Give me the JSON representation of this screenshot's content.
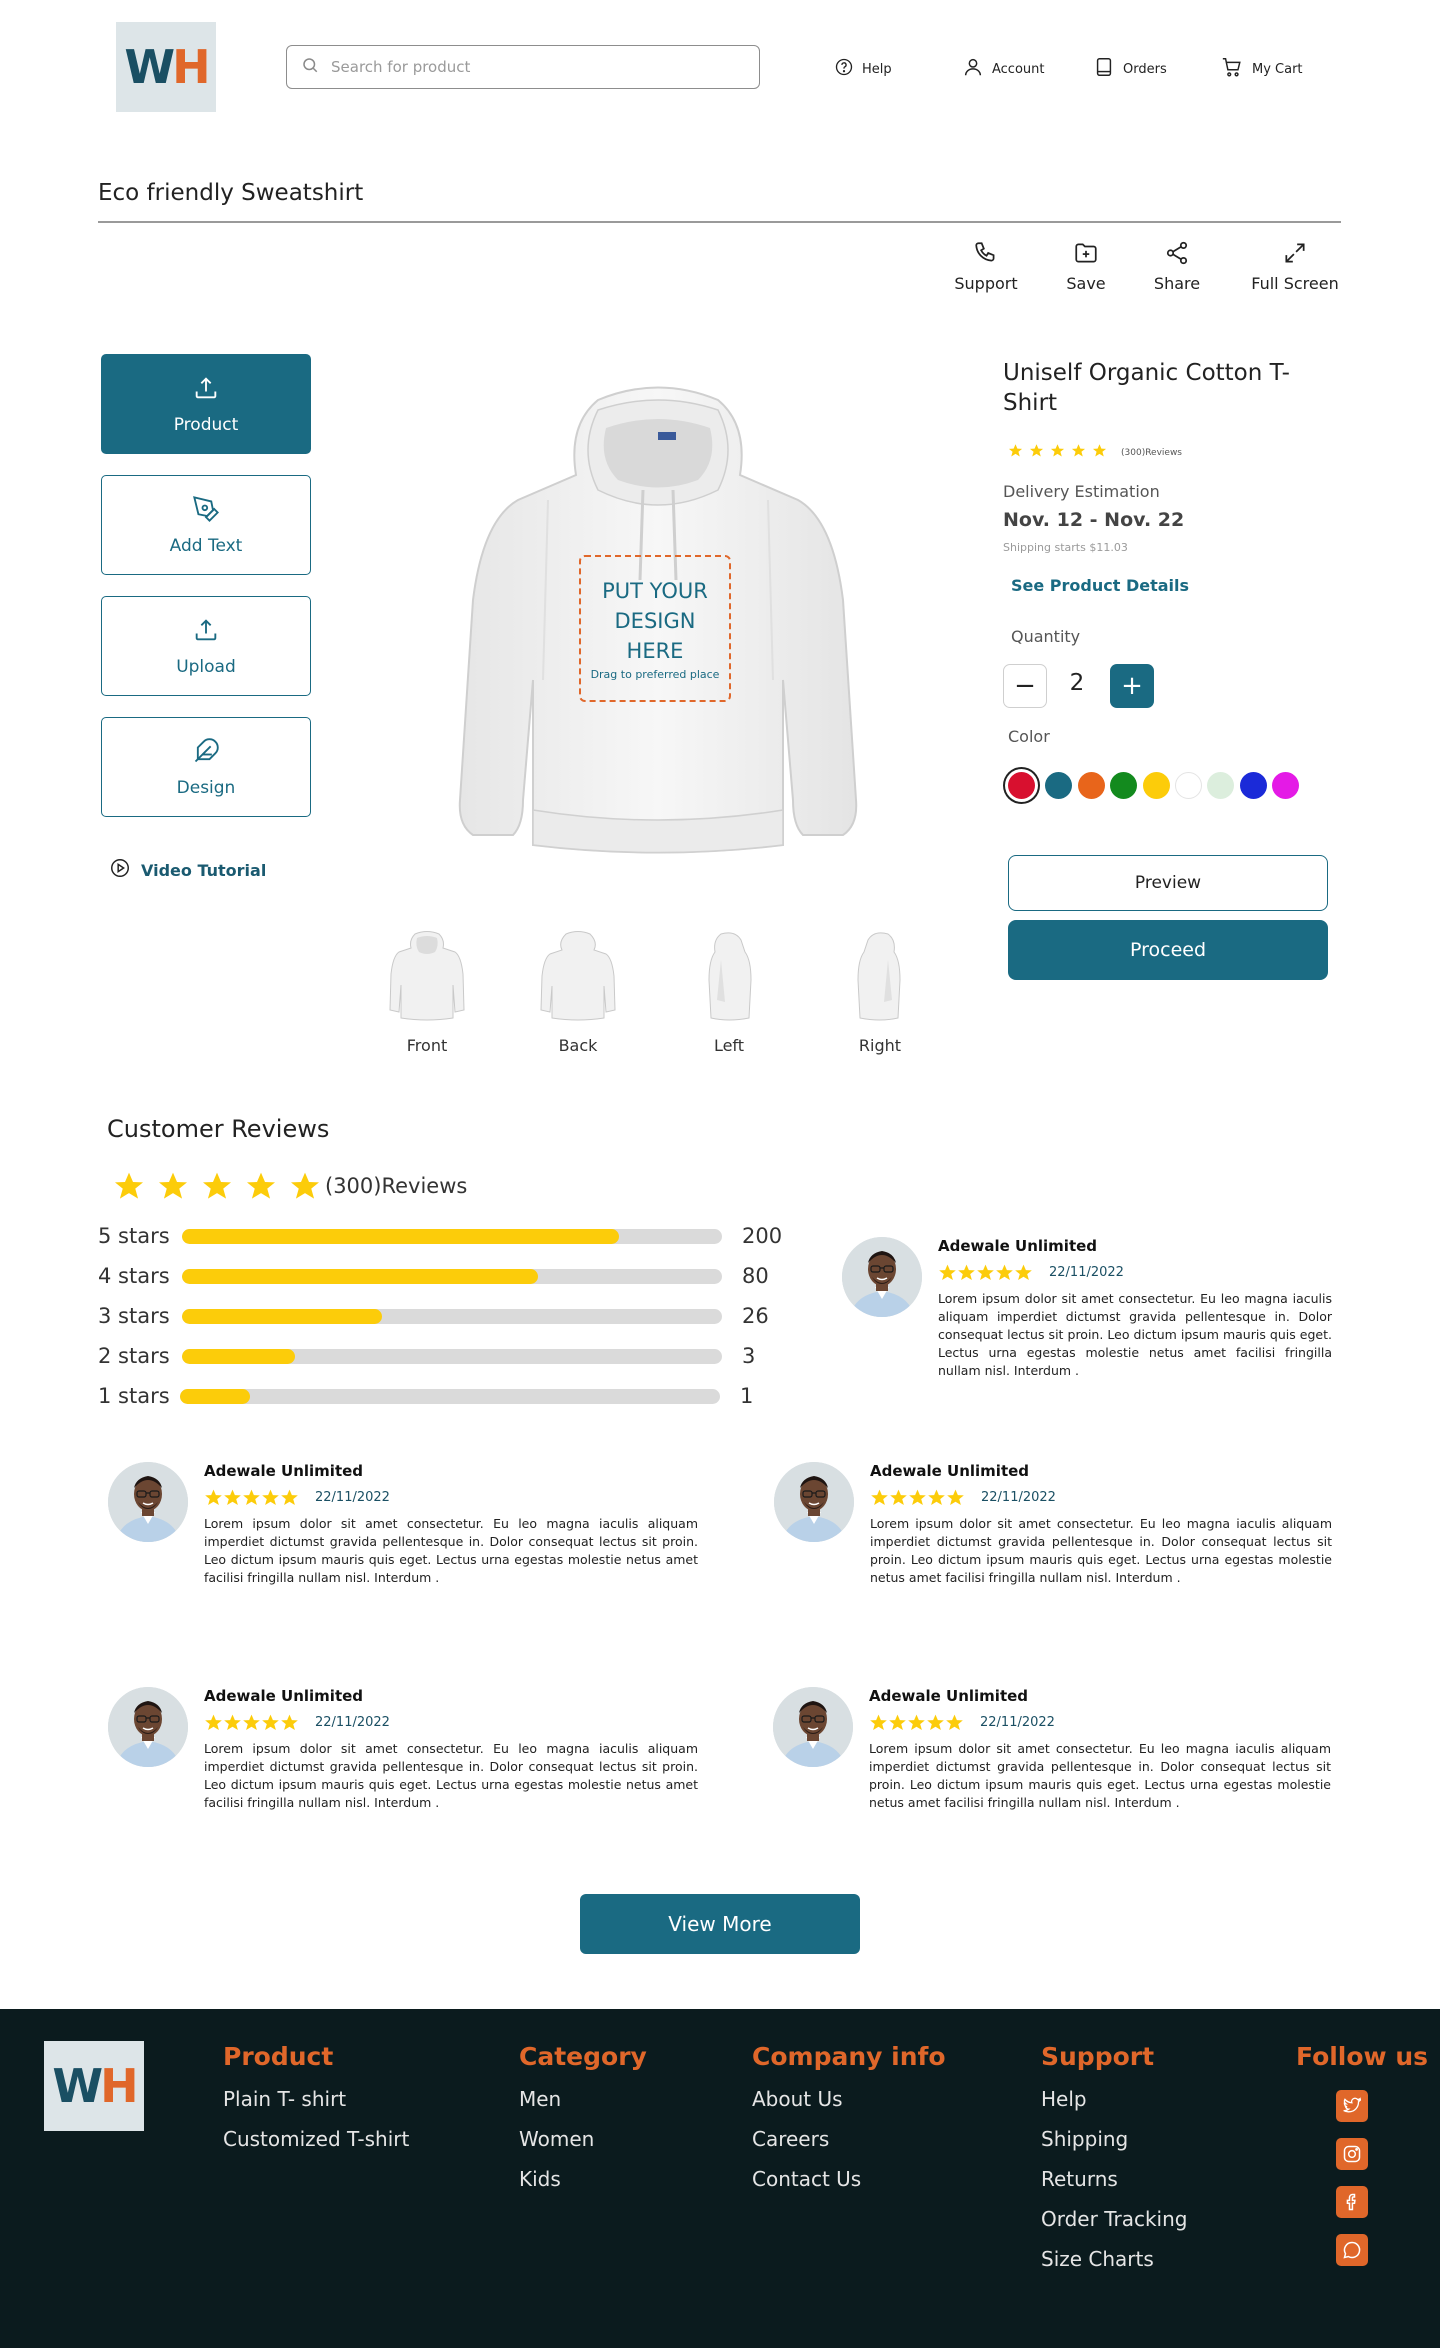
{
  "brand": {
    "logo_w": "W",
    "logo_h": "H"
  },
  "header": {
    "search_placeholder": "Search for product",
    "nav": [
      {
        "label": "Help",
        "icon": "help-circle-icon"
      },
      {
        "label": "Account",
        "icon": "user-icon"
      },
      {
        "label": "Orders",
        "icon": "orders-icon"
      },
      {
        "label": "My Cart",
        "icon": "cart-icon"
      }
    ]
  },
  "page_title": "Eco friendly Sweatshirt",
  "toolbar": [
    {
      "label": "Support",
      "icon": "phone-icon"
    },
    {
      "label": "Save",
      "icon": "folder-plus-icon"
    },
    {
      "label": "Share",
      "icon": "share-icon"
    },
    {
      "label": "Full Screen",
      "icon": "expand-icon"
    }
  ],
  "side_tools": [
    {
      "label": "Product",
      "icon": "upload-icon",
      "active": true
    },
    {
      "label": "Add Text",
      "icon": "pen-tool-icon",
      "active": false
    },
    {
      "label": "Upload",
      "icon": "upload-icon",
      "active": false
    },
    {
      "label": "Design",
      "icon": "feather-icon",
      "active": false
    }
  ],
  "video_tutorial": "Video Tutorial",
  "design_area": {
    "line1": "PUT YOUR",
    "line2": "DESIGN",
    "line3": "HERE",
    "hint": "Drag to preferred place"
  },
  "views": [
    "Front",
    "Back",
    "Left",
    "Right"
  ],
  "product": {
    "name": "Uniself Organic Cotton T-Shirt",
    "rating": 5,
    "reviews_small": "(300)Reviews",
    "delivery_label": "Delivery Estimation",
    "delivery_date": "Nov. 12 - Nov. 22",
    "shipping": "Shipping starts $11.03",
    "see_details": "See Product Details",
    "quantity_label": "Quantity",
    "quantity": "2",
    "color_label": "Color",
    "colors": [
      "#d8102f",
      "#1a6a82",
      "#e8651b",
      "#138a1e",
      "#fccc0a",
      "#ffffff",
      "#dceedd",
      "#1b2ad8",
      "#e41ae6"
    ],
    "selected_color": "#d8102f",
    "preview": "Preview",
    "proceed": "Proceed"
  },
  "reviews": {
    "title": "Customer Reviews",
    "rating": 5,
    "count_text": "(300)Reviews",
    "breakdown": [
      {
        "label": "5 stars",
        "count": "200",
        "fraction": 0.81
      },
      {
        "label": "4 stars",
        "count": "80",
        "fraction": 0.66
      },
      {
        "label": "3 stars",
        "count": "26",
        "fraction": 0.37
      },
      {
        "label": "2 stars",
        "count": "3",
        "fraction": 0.21
      },
      {
        "label": "1 stars",
        "count": "1",
        "fraction": 0.13
      }
    ],
    "items": [
      {
        "name": "Adewale Unlimited",
        "date": "22/11/2022",
        "rating": 5,
        "text": "Lorem ipsum dolor sit amet consectetur. Eu leo magna iaculis aliquam imperdiet dictumst gravida pellentesque in. Dolor consequat lectus sit proin. Leo dictum ipsum mauris quis eget. Lectus urna egestas molestie netus amet facilisi fringilla nullam nisl. Interdum ."
      },
      {
        "name": "Adewale Unlimited",
        "date": "22/11/2022",
        "rating": 5,
        "text": "Lorem ipsum dolor sit amet consectetur. Eu leo magna iaculis aliquam imperdiet dictumst gravida pellentesque in. Dolor consequat lectus sit proin. Leo dictum ipsum mauris quis eget. Lectus urna egestas molestie netus amet facilisi fringilla nullam nisl. Interdum ."
      },
      {
        "name": "Adewale Unlimited",
        "date": "22/11/2022",
        "rating": 5,
        "text": "Lorem ipsum dolor sit amet consectetur. Eu leo magna iaculis aliquam imperdiet dictumst gravida pellentesque in. Dolor consequat lectus sit proin. Leo dictum ipsum mauris quis eget. Lectus urna egestas molestie netus amet facilisi fringilla nullam nisl. Interdum ."
      },
      {
        "name": "Adewale Unlimited",
        "date": "22/11/2022",
        "rating": 5,
        "text": "Lorem ipsum dolor sit amet consectetur. Eu leo magna iaculis aliquam imperdiet dictumst gravida pellentesque in. Dolor consequat lectus sit proin. Leo dictum ipsum mauris quis eget. Lectus urna egestas molestie netus amet facilisi fringilla nullam nisl. Interdum ."
      },
      {
        "name": "Adewale Unlimited",
        "date": "22/11/2022",
        "rating": 5,
        "text": "Lorem ipsum dolor sit amet consectetur. Eu leo magna iaculis aliquam imperdiet dictumst gravida pellentesque in. Dolor consequat lectus sit proin. Leo dictum ipsum mauris quis eget. Lectus urna egestas molestie netus amet facilisi fringilla nullam nisl. Interdum ."
      }
    ],
    "view_more": "View More"
  },
  "footer": {
    "columns": [
      {
        "heading": "Product",
        "links": [
          "Plain T- shirt",
          "Customized T-shirt"
        ]
      },
      {
        "heading": "Category",
        "links": [
          "Men",
          "Women",
          "Kids"
        ]
      },
      {
        "heading": "Company info",
        "links": [
          "About Us",
          "Careers",
          "Contact Us"
        ]
      },
      {
        "heading": "Support",
        "links": [
          "Help",
          "Shipping",
          "Returns",
          "Order Tracking",
          "Size Charts"
        ]
      }
    ],
    "follow_heading": "Follow us",
    "social": [
      "twitter-icon",
      "instagram-icon",
      "facebook-icon",
      "chat-icon"
    ]
  },
  "colors": {
    "primary": "#1a6a82",
    "accent": "#e0672a",
    "star": "#fccc0a",
    "footer_bg": "#0b1b1e"
  }
}
